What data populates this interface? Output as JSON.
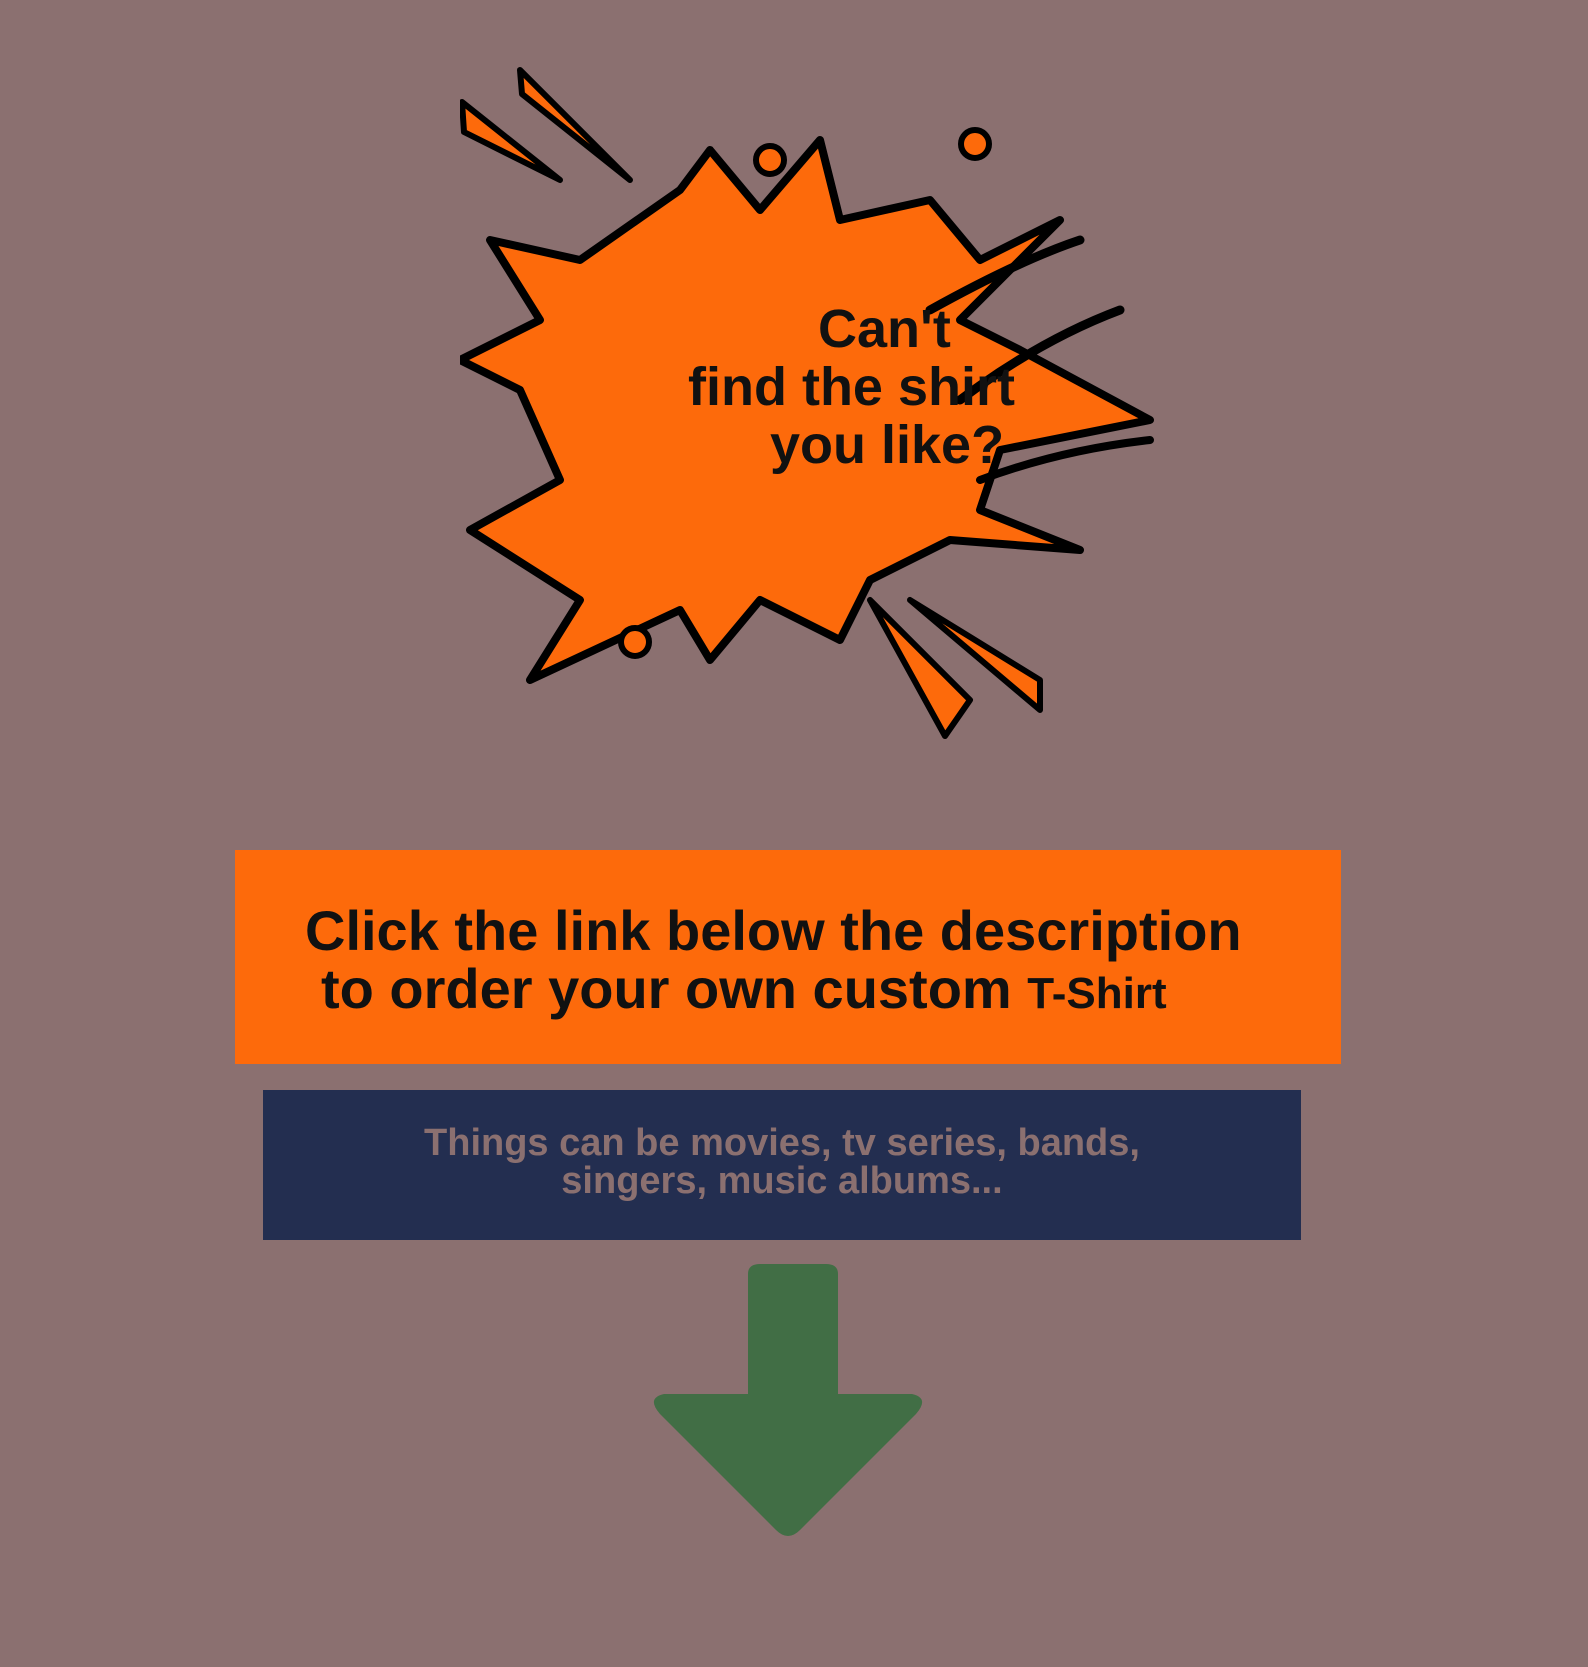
{
  "burst": {
    "line1": "Can't",
    "line2": "find the shirt",
    "line3": "you like?"
  },
  "cta": {
    "line1": "Click the link below the description",
    "line2_main": "to order your own custom",
    "line2_small": "T-Shirt"
  },
  "info": {
    "line1": "Things can be movies, tv series, bands,",
    "line2": "singers, music albums..."
  },
  "icons": {
    "burst": "comic-explosion-icon",
    "arrow": "arrow-down-icon"
  },
  "colors": {
    "background": "#8b7070",
    "accent_orange": "#fd6a0b",
    "navy": "#232e50",
    "arrow_green": "#416e45"
  }
}
